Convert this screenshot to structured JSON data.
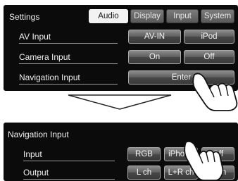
{
  "panel1": {
    "title": "Settings",
    "tabs": [
      {
        "label": "Audio",
        "selected": true
      },
      {
        "label": "Display",
        "selected": false
      },
      {
        "label": "Input",
        "selected": false
      },
      {
        "label": "System",
        "selected": false
      }
    ],
    "rows": [
      {
        "label": "AV Input",
        "options": [
          "AV-IN",
          "iPod"
        ]
      },
      {
        "label": "Camera Input",
        "options": [
          "On",
          "Off"
        ]
      },
      {
        "label": "Navigation Input",
        "options": [
          "Enter"
        ]
      }
    ]
  },
  "panel2": {
    "title": "Navigation Input",
    "rows": [
      {
        "label": "Input",
        "options": [
          "RGB",
          "iPhone",
          "Off"
        ]
      },
      {
        "label": "Output",
        "options": [
          "L ch",
          "L+R ch",
          "R ch"
        ]
      }
    ]
  },
  "icons": {
    "transition": "down-arrow-icon",
    "touch": "hand-pointer-icon"
  },
  "colors": {
    "panel_bg": "#0b0b0b",
    "button": "#5f5f5f",
    "selected_tab": "#f2f2f2"
  }
}
